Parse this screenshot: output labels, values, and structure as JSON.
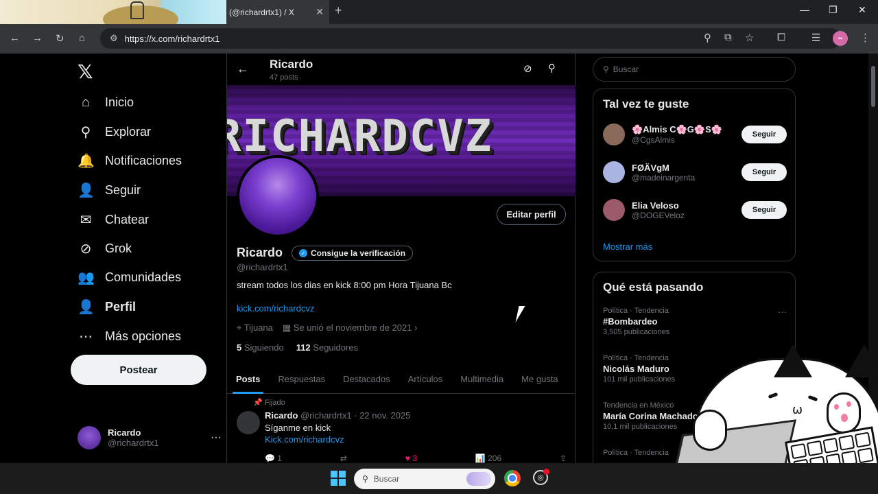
{
  "browser": {
    "tab_title": "(@richardrtx1) / X",
    "tab_close": "✕",
    "new_tab": "+",
    "url": "https://x.com/richardrtx1",
    "window_controls": {
      "minimize": "—",
      "restore": "❐",
      "close": "✕"
    },
    "toolbar_icons": [
      "zoom-icon",
      "install-icon",
      "bookmark-star-icon",
      "extensions-icon",
      "media-icon",
      "profile-icon",
      "menu-icon"
    ],
    "profile_initials": "••"
  },
  "nav": {
    "logo": "𝕏",
    "items": [
      {
        "label": "Inicio",
        "icon": "⌂"
      },
      {
        "label": "Explorar",
        "icon": "⚲"
      },
      {
        "label": "Notificaciones",
        "icon": "🔔"
      },
      {
        "label": "Seguir",
        "icon": "👤"
      },
      {
        "label": "Chatear",
        "icon": "✉"
      },
      {
        "label": "Grok",
        "icon": "⊘"
      },
      {
        "label": "Comunidades",
        "icon": "👥"
      },
      {
        "label": "Perfil",
        "icon": "👤"
      },
      {
        "label": "Más opciones",
        "icon": "⋯"
      }
    ],
    "post_button": "Postear",
    "account": {
      "name": "Ricardo",
      "handle": "@richardrtx1",
      "more": "···"
    }
  },
  "profile_header": {
    "back": "←",
    "name": "Ricardo",
    "posts_count": "47 posts"
  },
  "profile": {
    "banner_text": "RICHARDCVZ",
    "edit_button": "Editar perfil",
    "name": "Ricardo",
    "verify_button": "Consigue la verificación",
    "handle": "@richardrtx1",
    "bio": "stream todos los dias en kick 8:00 pm Hora Tijuana Bc",
    "link": "kick.com/richardcvz",
    "location": "Tijuana",
    "joined": "Se unió el noviembre de 2021",
    "following_count": "5",
    "following_label": "Siguiendo",
    "followers_count": "112",
    "followers_label": "Seguidores"
  },
  "tabs": [
    "Posts",
    "Respuestas",
    "Destacados",
    "Artículos",
    "Multimedia",
    "Me gusta"
  ],
  "tweet": {
    "pinned_label": "Fijado",
    "author": "Ricardo",
    "meta": "@richardrtx1 · 22 nov. 2025",
    "text": "Síganme en kick",
    "link": "Kick.com/richardcvz",
    "replies": "1",
    "retweets": "",
    "likes": "3",
    "views": "206"
  },
  "sidebar": {
    "search_placeholder": "Buscar",
    "who_to_follow": {
      "title": "Tal vez te guste",
      "items": [
        {
          "name": "🌸Almis C🌸G🌸S🌸",
          "handle": "@CgsAlmis",
          "button": "Seguir",
          "color": "#8a6a5a"
        },
        {
          "name": "FØÄVgM",
          "handle": "@madeinargenta",
          "button": "Seguir",
          "color": "#a9b4e0"
        },
        {
          "name": "Elia Veloso",
          "handle": "@DOGEVeloz",
          "button": "Seguir",
          "color": "#9a5a6a"
        }
      ],
      "show_more": "Mostrar más"
    },
    "trending": {
      "title": "Qué está pasando",
      "items": [
        {
          "context": "Política · Tendencia",
          "topic": "#Bombardeo",
          "count": "3,505 publicaciones"
        },
        {
          "context": "Política · Tendencia",
          "topic": "Nicolás Maduro",
          "count": "101 mil publicaciones"
        },
        {
          "context": "Tendencia en México",
          "topic": "María Corina Machado",
          "count": "10,1 mil publicaciones"
        },
        {
          "context": "Política · Tendencia",
          "topic": "",
          "count": ""
        }
      ]
    }
  },
  "taskbar": {
    "search_placeholder": "Buscar"
  }
}
